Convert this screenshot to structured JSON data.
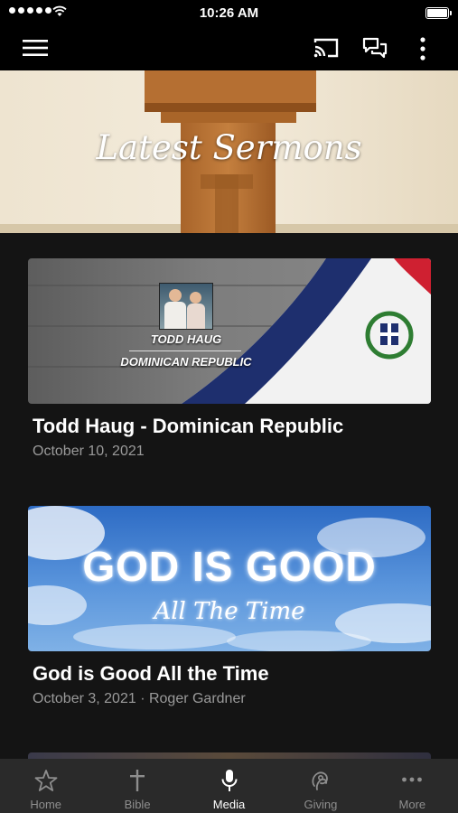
{
  "status_bar": {
    "time": "10:26 AM"
  },
  "hero": {
    "title": "Latest Sermons"
  },
  "sermons": [
    {
      "title": "Todd Haug - Dominican Republic",
      "meta": "October 10, 2021",
      "thumb_line1": "TODD HAUG",
      "thumb_line2": "DOMINICAN REPUBLIC"
    },
    {
      "title": "God is Good All the Time",
      "meta": "October 3, 2021 · Roger Gardner",
      "thumb_line1": "GOD IS GOOD",
      "thumb_line2": "All The Time"
    }
  ],
  "tabs": [
    {
      "label": "Home",
      "icon": "star-icon",
      "active": false
    },
    {
      "label": "Bible",
      "icon": "cross-icon",
      "active": false
    },
    {
      "label": "Media",
      "icon": "microphone-icon",
      "active": true
    },
    {
      "label": "Giving",
      "icon": "giving-icon",
      "active": false
    },
    {
      "label": "More",
      "icon": "more-dots-icon",
      "active": false
    }
  ],
  "colors": {
    "background": "#141414",
    "app_bar": "#000000",
    "tab_bar": "#2a2a2a",
    "tab_inactive": "#8e8e8e",
    "meta_text": "#9a9a9a"
  }
}
